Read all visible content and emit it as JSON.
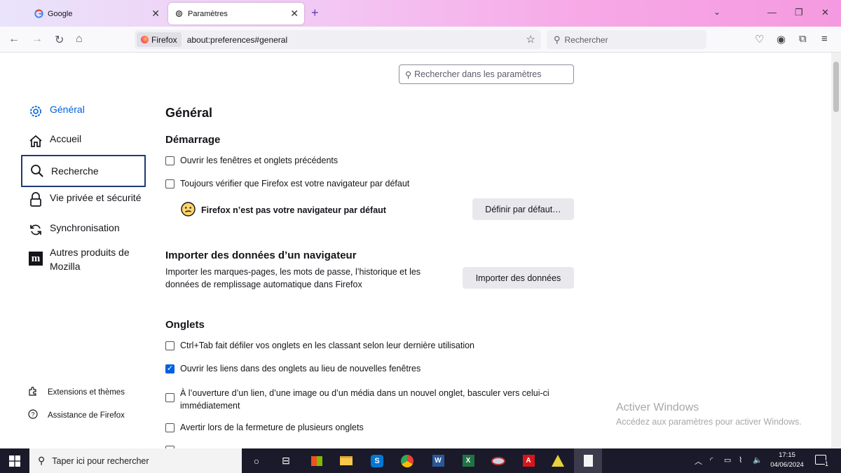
{
  "tabs": [
    {
      "title": "Google",
      "favicon": "google-icon"
    },
    {
      "title": "Paramètres",
      "favicon": "gear-icon"
    }
  ],
  "navbar": {
    "identity_label": "Firefox",
    "url": "about:preferences#general",
    "search_placeholder": "Rechercher"
  },
  "prefs_search_placeholder": "Rechercher dans les paramètres",
  "sidebar": {
    "items": [
      {
        "label": "Général",
        "icon": "gear-icon"
      },
      {
        "label": "Accueil",
        "icon": "home-icon"
      },
      {
        "label": "Recherche",
        "icon": "search-icon"
      },
      {
        "label": "Vie privée et sécurité",
        "icon": "lock-icon"
      },
      {
        "label": "Synchronisation",
        "icon": "sync-icon"
      },
      {
        "label_line1": "Autres produits de",
        "label_line2": "Mozilla",
        "icon": "mozilla-icon"
      }
    ],
    "footer": [
      {
        "label": "Extensions et thèmes",
        "icon": "puzzle-icon"
      },
      {
        "label": "Assistance de Firefox",
        "icon": "help-icon"
      }
    ]
  },
  "main": {
    "title": "Général",
    "startup": {
      "heading": "Démarrage",
      "restore_session": "Ouvrir les fenêtres et onglets précédents",
      "check_default": "Toujours vérifier que Firefox est votre navigateur par défaut",
      "not_default_msg": "Firefox n’est pas votre navigateur par défaut",
      "set_default_btn": "Définir par défaut…"
    },
    "import": {
      "heading": "Importer des données d’un navigateur",
      "desc_line1": "Importer les marques-pages, les mots de passe, l’historique et les",
      "desc_line2": "données de remplissage automatique dans Firefox",
      "import_btn": "Importer des données"
    },
    "tabs_section": {
      "heading": "Onglets",
      "ctrl_tab": "Ctrl+Tab fait défiler vos onglets en les classant selon leur dernière utilisation",
      "open_links": "Ouvrir les liens dans des onglets au lieu de nouvelles fenêtres",
      "switch_line1": "À l’ouverture d’un lien, d’une image ou d’un média dans un nouvel onglet, basculer vers celui-ci",
      "switch_line2": "immédiatement",
      "warn_close": "Avertir lors de la fermeture de plusieurs onglets"
    }
  },
  "watermark": {
    "line1": "Activer Windows",
    "line2": "Accédez aux paramètres pour activer Windows."
  },
  "taskbar": {
    "search_placeholder": "Taper ici pour rechercher",
    "time": "17:15",
    "date": "04/06/2024",
    "notification_count": "1"
  }
}
